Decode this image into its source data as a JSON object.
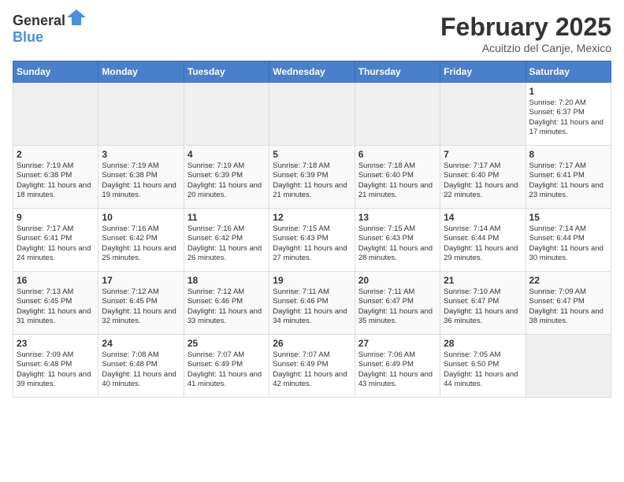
{
  "header": {
    "logo_general": "General",
    "logo_blue": "Blue",
    "month": "February 2025",
    "location": "Acuitzio del Canje, Mexico"
  },
  "weekdays": [
    "Sunday",
    "Monday",
    "Tuesday",
    "Wednesday",
    "Thursday",
    "Friday",
    "Saturday"
  ],
  "weeks": [
    [
      {
        "day": "",
        "info": ""
      },
      {
        "day": "",
        "info": ""
      },
      {
        "day": "",
        "info": ""
      },
      {
        "day": "",
        "info": ""
      },
      {
        "day": "",
        "info": ""
      },
      {
        "day": "",
        "info": ""
      },
      {
        "day": "1",
        "info": "Sunrise: 7:20 AM\nSunset: 6:37 PM\nDaylight: 11 hours and 17 minutes."
      }
    ],
    [
      {
        "day": "2",
        "info": "Sunrise: 7:19 AM\nSunset: 6:38 PM\nDaylight: 11 hours and 18 minutes."
      },
      {
        "day": "3",
        "info": "Sunrise: 7:19 AM\nSunset: 6:38 PM\nDaylight: 11 hours and 19 minutes."
      },
      {
        "day": "4",
        "info": "Sunrise: 7:19 AM\nSunset: 6:39 PM\nDaylight: 11 hours and 20 minutes."
      },
      {
        "day": "5",
        "info": "Sunrise: 7:18 AM\nSunset: 6:39 PM\nDaylight: 11 hours and 21 minutes."
      },
      {
        "day": "6",
        "info": "Sunrise: 7:18 AM\nSunset: 6:40 PM\nDaylight: 11 hours and 21 minutes."
      },
      {
        "day": "7",
        "info": "Sunrise: 7:17 AM\nSunset: 6:40 PM\nDaylight: 11 hours and 22 minutes."
      },
      {
        "day": "8",
        "info": "Sunrise: 7:17 AM\nSunset: 6:41 PM\nDaylight: 11 hours and 23 minutes."
      }
    ],
    [
      {
        "day": "9",
        "info": "Sunrise: 7:17 AM\nSunset: 6:41 PM\nDaylight: 11 hours and 24 minutes."
      },
      {
        "day": "10",
        "info": "Sunrise: 7:16 AM\nSunset: 6:42 PM\nDaylight: 11 hours and 25 minutes."
      },
      {
        "day": "11",
        "info": "Sunrise: 7:16 AM\nSunset: 6:42 PM\nDaylight: 11 hours and 26 minutes."
      },
      {
        "day": "12",
        "info": "Sunrise: 7:15 AM\nSunset: 6:43 PM\nDaylight: 11 hours and 27 minutes."
      },
      {
        "day": "13",
        "info": "Sunrise: 7:15 AM\nSunset: 6:43 PM\nDaylight: 11 hours and 28 minutes."
      },
      {
        "day": "14",
        "info": "Sunrise: 7:14 AM\nSunset: 6:44 PM\nDaylight: 11 hours and 29 minutes."
      },
      {
        "day": "15",
        "info": "Sunrise: 7:14 AM\nSunset: 6:44 PM\nDaylight: 11 hours and 30 minutes."
      }
    ],
    [
      {
        "day": "16",
        "info": "Sunrise: 7:13 AM\nSunset: 6:45 PM\nDaylight: 11 hours and 31 minutes."
      },
      {
        "day": "17",
        "info": "Sunrise: 7:12 AM\nSunset: 6:45 PM\nDaylight: 11 hours and 32 minutes."
      },
      {
        "day": "18",
        "info": "Sunrise: 7:12 AM\nSunset: 6:46 PM\nDaylight: 11 hours and 33 minutes."
      },
      {
        "day": "19",
        "info": "Sunrise: 7:11 AM\nSunset: 6:46 PM\nDaylight: 11 hours and 34 minutes."
      },
      {
        "day": "20",
        "info": "Sunrise: 7:11 AM\nSunset: 6:47 PM\nDaylight: 11 hours and 35 minutes."
      },
      {
        "day": "21",
        "info": "Sunrise: 7:10 AM\nSunset: 6:47 PM\nDaylight: 11 hours and 36 minutes."
      },
      {
        "day": "22",
        "info": "Sunrise: 7:09 AM\nSunset: 6:47 PM\nDaylight: 11 hours and 38 minutes."
      }
    ],
    [
      {
        "day": "23",
        "info": "Sunrise: 7:09 AM\nSunset: 6:48 PM\nDaylight: 11 hours and 39 minutes."
      },
      {
        "day": "24",
        "info": "Sunrise: 7:08 AM\nSunset: 6:48 PM\nDaylight: 11 hours and 40 minutes."
      },
      {
        "day": "25",
        "info": "Sunrise: 7:07 AM\nSunset: 6:49 PM\nDaylight: 11 hours and 41 minutes."
      },
      {
        "day": "26",
        "info": "Sunrise: 7:07 AM\nSunset: 6:49 PM\nDaylight: 11 hours and 42 minutes."
      },
      {
        "day": "27",
        "info": "Sunrise: 7:06 AM\nSunset: 6:49 PM\nDaylight: 11 hours and 43 minutes."
      },
      {
        "day": "28",
        "info": "Sunrise: 7:05 AM\nSunset: 6:50 PM\nDaylight: 11 hours and 44 minutes."
      },
      {
        "day": "",
        "info": ""
      }
    ]
  ]
}
